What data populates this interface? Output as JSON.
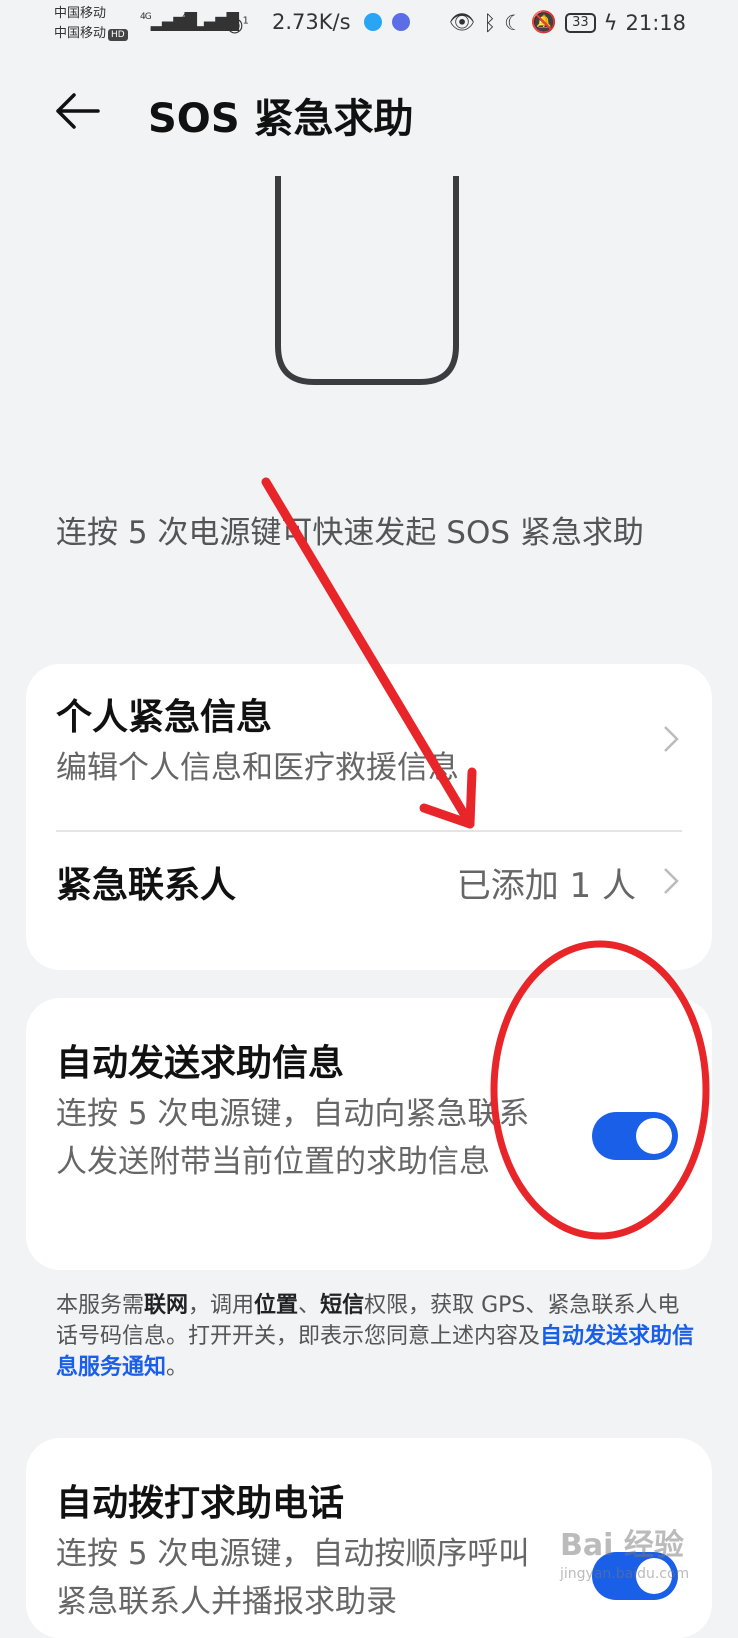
{
  "status_bar": {
    "carrier1": "中国移动",
    "carrier2": "中国移动",
    "hd": "HD",
    "signal1": "4G",
    "signal2": "4G",
    "hotspot_count": "1",
    "net_speed": "2.73K/s",
    "battery": "33",
    "time": "21:18"
  },
  "header": {
    "title": "SOS 紧急求助"
  },
  "intro_text": "连按 5 次电源键可快速发起 SOS 紧急求助",
  "card_info": {
    "personal_title": "个人紧急信息",
    "personal_sub": "编辑个人信息和医疗救援信息",
    "contacts_title": "紧急联系人",
    "contacts_value": "已添加 1 人"
  },
  "card_auto_message": {
    "title": "自动发送求助信息",
    "description": "连按 5 次电源键，自动向紧急联系人发送附带当前位置的求助信息",
    "enabled": true
  },
  "notice": {
    "p1": "本服务需",
    "b1": "联网",
    "p2": "，调用",
    "b2": "位置",
    "p3": "、",
    "b3": "短信",
    "p4": "权限，获取 GPS、紧急联系人电话号码信息。打开开关，即表示您同意上述内容及",
    "link": "自动发送求助信息服务通知",
    "p5": "。"
  },
  "card_auto_call": {
    "title": "自动拨打求助电话",
    "description": "连按 5 次电源键，自动按顺序呼叫紧急联系人并播报求助录",
    "enabled": true
  },
  "watermark": {
    "brand": "Bai 经验",
    "url": "jingyan.baidu.com"
  },
  "colors": {
    "accent": "#1a5fe8",
    "annotation": "#e8262a",
    "background": "#f1f3f5"
  }
}
